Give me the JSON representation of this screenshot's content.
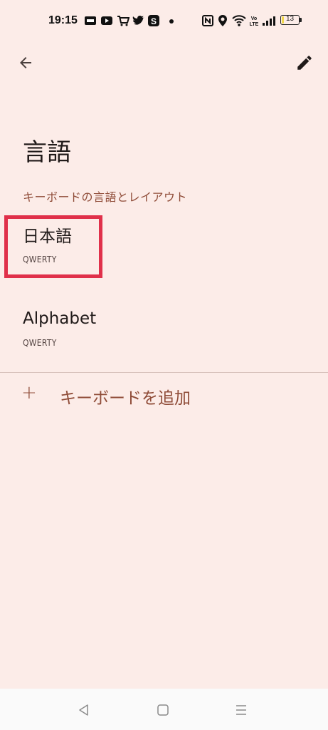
{
  "status_bar": {
    "time": "19:15",
    "battery_level": "13",
    "battery_fraction": 0.13
  },
  "app_bar": {
    "back_icon": "arrow-back-icon",
    "edit_icon": "pencil-icon"
  },
  "page": {
    "title": "言語",
    "section_header": "キーボードの言語とレイアウト"
  },
  "languages": [
    {
      "name": "日本語",
      "layout": "QWERTY"
    },
    {
      "name": "Alphabet",
      "layout": "QWERTY"
    }
  ],
  "add_keyboard": {
    "icon": "+",
    "label": "キーボードを追加"
  },
  "colors": {
    "background": "#fcece8",
    "accent": "#8f4c38",
    "highlight": "#e0304a"
  }
}
